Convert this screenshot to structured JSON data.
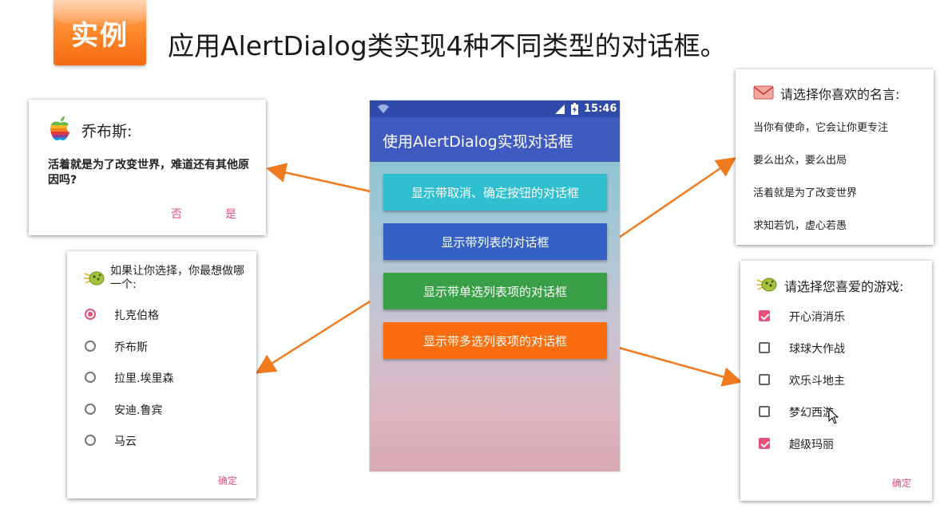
{
  "header": {
    "badge": "实例",
    "title": "应用AlertDialog类实现4种不同类型的对话框。"
  },
  "phone": {
    "status_time": "15:46",
    "app_title": "使用AlertDialog实现对话框",
    "buttons": [
      {
        "label": "显示带取消、确定按钮的对话框",
        "color": "#2fbfcf"
      },
      {
        "label": "显示带列表的对话框",
        "color": "#3562c4"
      },
      {
        "label": "显示带单选列表项的对话框",
        "color": "#3aa048"
      },
      {
        "label": "显示带多选列表项的对话框",
        "color": "#fb6d0e"
      }
    ]
  },
  "dialog_confirm": {
    "icon": "apple-icon",
    "title": "乔布斯:",
    "message": "活着就是为了改变世界，难道还有其他原因吗?",
    "negative": "否",
    "positive": "是"
  },
  "dialog_list": {
    "icon": "envelope-icon",
    "title": "请选择你喜欢的名言:",
    "items": [
      "当你有使命，它会让你更专注",
      "要么出众，要么出局",
      "活着就是为了改变世界",
      "求知若饥，虚心若愚"
    ]
  },
  "dialog_single": {
    "icon": "bug-icon",
    "title": "如果让你选择，你最想做哪一个:",
    "items": [
      {
        "label": "扎克伯格",
        "checked": true
      },
      {
        "label": "乔布斯",
        "checked": false
      },
      {
        "label": "拉里.埃里森",
        "checked": false
      },
      {
        "label": "安迪.鲁宾",
        "checked": false
      },
      {
        "label": "马云",
        "checked": false
      }
    ],
    "ok": "确定"
  },
  "dialog_multi": {
    "icon": "bug-icon",
    "title": "请选择您喜爱的游戏:",
    "items": [
      {
        "label": "开心消消乐",
        "checked": true
      },
      {
        "label": "球球大作战",
        "checked": false
      },
      {
        "label": "欢乐斗地主",
        "checked": false
      },
      {
        "label": "梦幻西游",
        "checked": false
      },
      {
        "label": "超级玛丽",
        "checked": true
      }
    ],
    "ok": "确定"
  },
  "colors": {
    "arrow": "#f07a1e",
    "accent": "#e8507a"
  }
}
